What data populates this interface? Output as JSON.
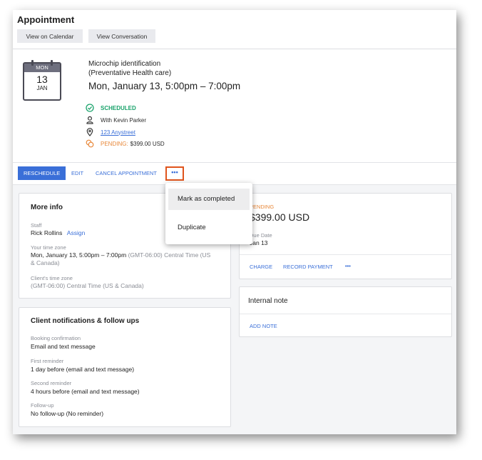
{
  "header": {
    "title": "Appointment",
    "view_calendar": "View on Calendar",
    "view_conversation": "View Conversation"
  },
  "summary": {
    "cal_month": "MON",
    "cal_day": "13",
    "cal_month2": "JAN",
    "service_line1": "Microchip identification",
    "service_line2": "(Preventative Health care)",
    "datetime": "Mon, January 13, 5:00pm – 7:00pm",
    "status": "SCHEDULED",
    "staff": "With Kevin Parker",
    "location": "123 Anystreet",
    "payment_label": "PENDING:",
    "payment_amount": "$399.00 USD",
    "colors": {
      "status": "#1aa36b",
      "pending": "#e8883a",
      "link": "#3a6fd8"
    }
  },
  "actions": {
    "reschedule": "RESCHEDULE",
    "edit": "EDIT",
    "cancel": "CANCEL APPOINTMENT",
    "more": "•••"
  },
  "dropdown": {
    "items": [
      "Mark as completed",
      "Duplicate"
    ]
  },
  "more_info": {
    "title": "More info",
    "staff_label": "Staff",
    "staff_value": "Rick Rollins",
    "assign": "Assign",
    "your_tz_label": "Your time zone",
    "your_tz_value": "Mon, January 13, 5:00pm – 7:00pm",
    "your_tz_zone_a": "(GMT-06:00) Central Time (US",
    "your_tz_zone_b": "& Canada)",
    "client_tz_label": "Client's time zone",
    "client_tz_value": "(GMT-06:00) Central Time (US & Canada)"
  },
  "notifications": {
    "title": "Client notifications & follow ups",
    "booking_label": "Booking confirmation",
    "booking_value": "Email and text message",
    "first_label": "First reminder",
    "first_value": "1 day before (email and text message)",
    "second_label": "Second reminder",
    "second_value": "4 hours before (email and text message)",
    "followup_label": "Follow-up",
    "followup_value": "No follow-up (No reminder)"
  },
  "payment_card": {
    "status": "PENDING",
    "amount": "$399.00 USD",
    "due_label": "Due Date",
    "due_value": "Jan 13",
    "charge": "CHARGE",
    "record": "RECORD PAYMENT",
    "more": "•••"
  },
  "internal_note": {
    "title": "Internal note",
    "add_note": "ADD NOTE"
  }
}
